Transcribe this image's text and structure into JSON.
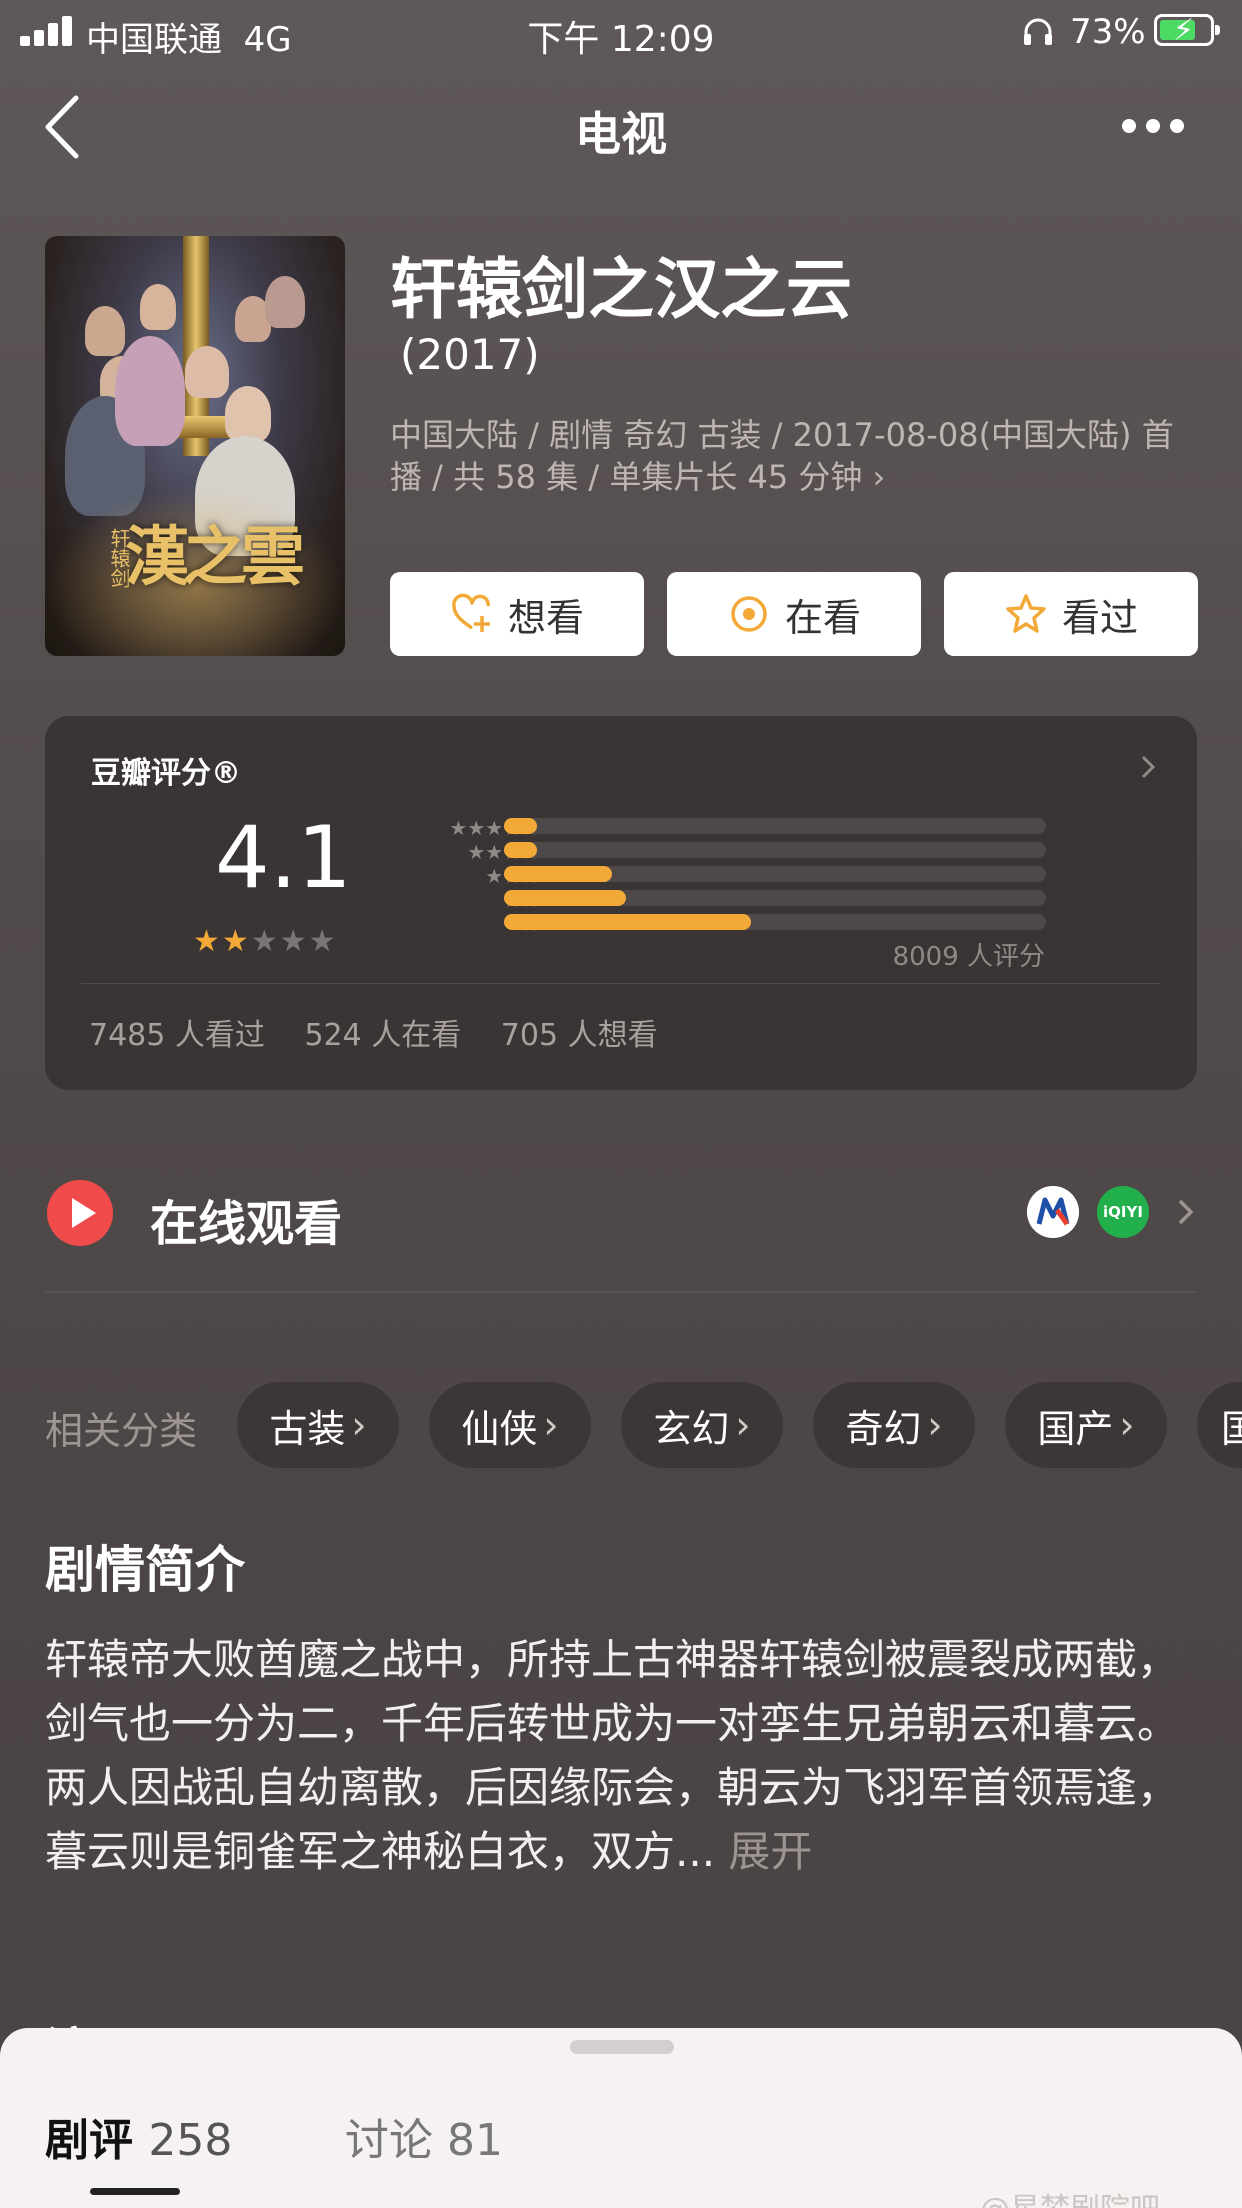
{
  "status_bar": {
    "carrier": "中国联通",
    "network": "4G",
    "time": "下午 12:09",
    "battery_percent": "73%",
    "battery_level": 0.73
  },
  "nav": {
    "title": "电视"
  },
  "show": {
    "title": "轩辕剑之汉之云",
    "year": "(2017)",
    "meta": "中国大陆 / 剧情 奇幻 古装 / 2017-08-08(中国大陆) 首播 / 共 58 集 / 单集片长 45 分钟 ›",
    "poster_text": "漢之雲",
    "poster_small_text": "轩辕剑"
  },
  "actions": {
    "want": "想看",
    "watching": "在看",
    "watched": "看过"
  },
  "rating": {
    "title": "豆瓣评分®",
    "score": "4.1",
    "stars_filled": 2,
    "stars_total": 5,
    "distribution_labels": [
      "★★★★★",
      "★★★★",
      "★★★",
      "★★",
      "★"
    ],
    "distribution": [
      0.06,
      0.06,
      0.2,
      0.225,
      0.455
    ],
    "count_text": "8009 人评分",
    "watched_text": "7485 人看过",
    "watching_text": "524 人在看",
    "want_text": "705 人想看"
  },
  "online": {
    "label": "在线观看",
    "play_color": "#f04b4b",
    "iqiyi_text": "iQIYI"
  },
  "categories": {
    "label": "相关分类",
    "items": [
      "古装",
      "仙侠",
      "玄幻",
      "奇幻",
      "国产",
      "国"
    ]
  },
  "synopsis": {
    "title": "剧情简介",
    "text": "轩辕帝大败酋魔之战中，所持上古神器轩辕剑被震裂成两截，剑气也一分为二，千年后转世成为一对孪生兄弟朝云和暮云。两人因战乱自幼离散，后因缘际会，朝云为飞羽军首领焉逢，暮云则是铜雀军之神秘白衣，双方...",
    "more": "展开"
  },
  "cast_peek_title": "演职员",
  "sheet": {
    "tab1_label": "剧评",
    "tab1_count": "258",
    "tab2_label": "讨论",
    "tab2_count": "81",
    "watermark": "@星梦剧院吧"
  },
  "colors": {
    "accent_orange": "#f2a937",
    "background": "#534c4c"
  }
}
